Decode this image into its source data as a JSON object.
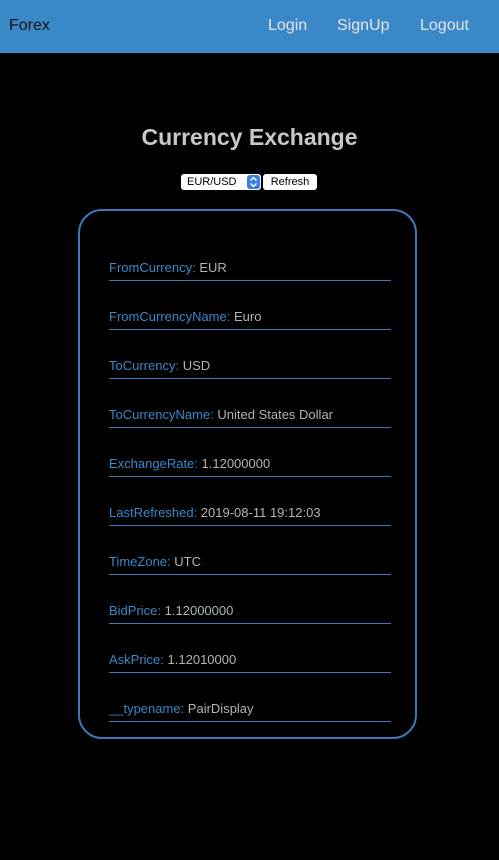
{
  "navbar": {
    "brand": "Forex",
    "links": [
      "Login",
      "SignUp",
      "Logout"
    ]
  },
  "page": {
    "title": "Currency Exchange"
  },
  "controls": {
    "pair_select_value": "EUR/USD",
    "refresh_label": "Refresh"
  },
  "details": [
    {
      "key": "FromCurrency",
      "value": "EUR"
    },
    {
      "key": "FromCurrencyName",
      "value": "Euro"
    },
    {
      "key": "ToCurrency",
      "value": "USD"
    },
    {
      "key": "ToCurrencyName",
      "value": "United States Dollar"
    },
    {
      "key": "ExchangeRate",
      "value": "1.12000000"
    },
    {
      "key": "LastRefreshed",
      "value": "2019-08-11 19:12:03"
    },
    {
      "key": "TimeZone",
      "value": "UTC"
    },
    {
      "key": "BidPrice",
      "value": "1.12000000"
    },
    {
      "key": "AskPrice",
      "value": "1.12010000"
    },
    {
      "key": "__typename",
      "value": "PairDisplay"
    }
  ],
  "colors": {
    "navbar": "#3a88c8",
    "background": "#000000",
    "accent": "#3a78b6",
    "value_text": "#b4b4b4"
  },
  "icons": {
    "select_arrow": "chevron-updown-icon"
  }
}
